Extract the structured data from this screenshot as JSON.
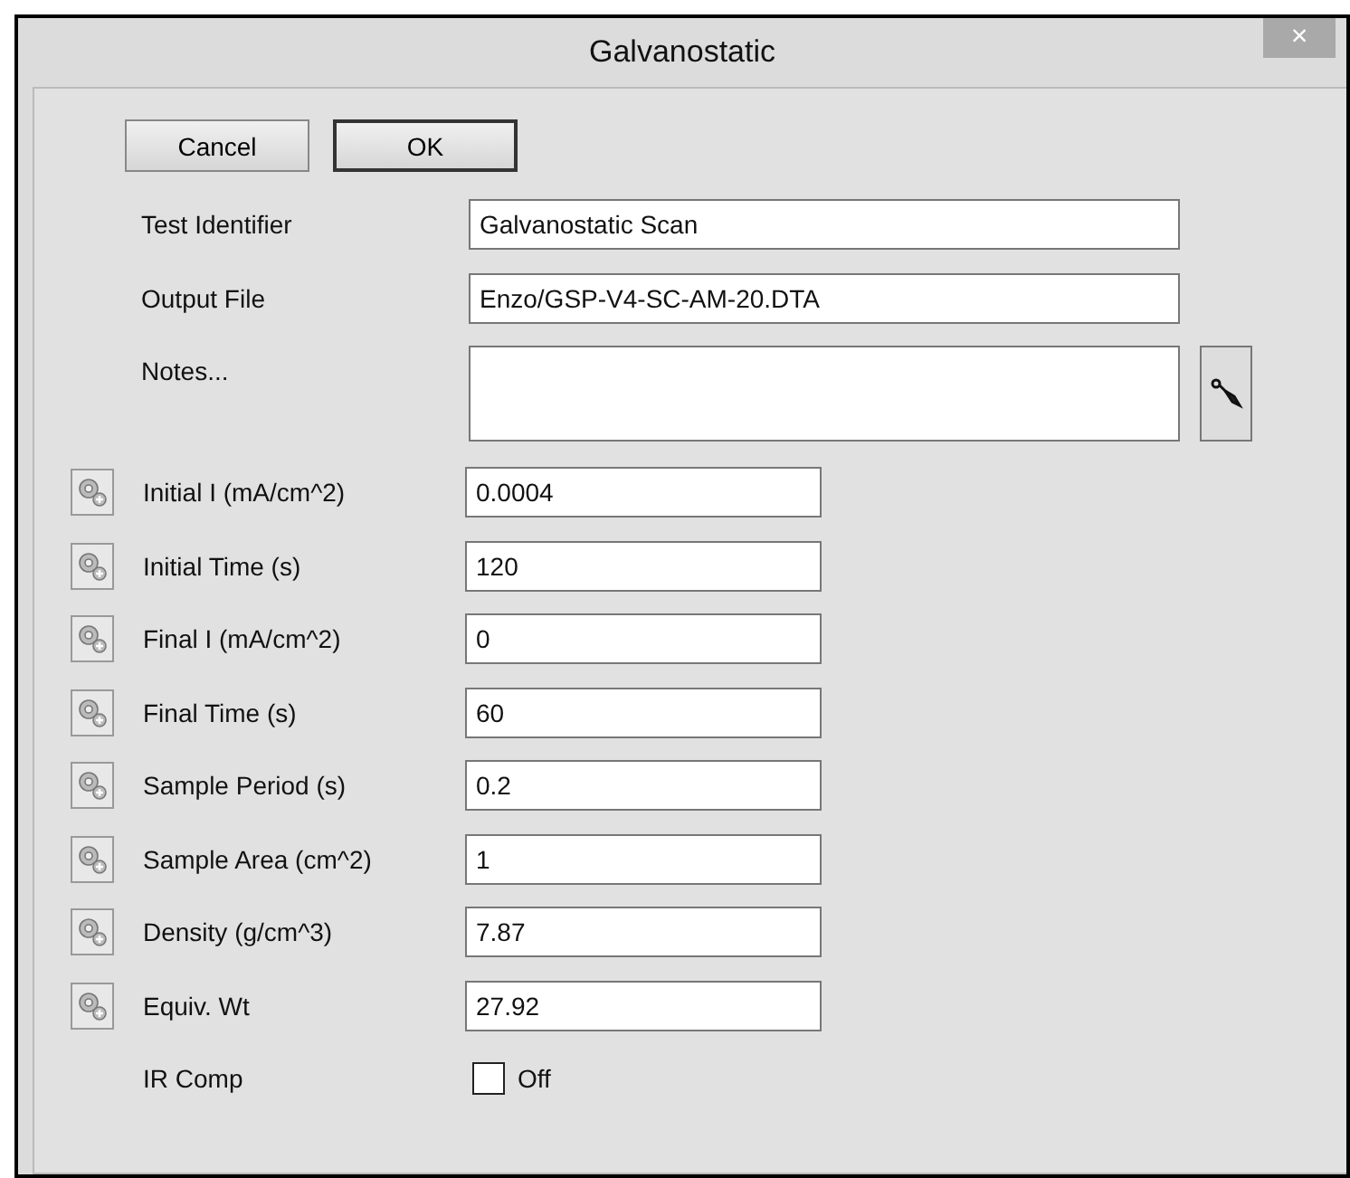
{
  "window": {
    "title": "Galvanostatic",
    "close": "×"
  },
  "buttons": [
    "Cancel",
    "OK"
  ],
  "fields": [
    {
      "label": "Test Identifier",
      "value": "Galvanostatic Scan"
    },
    {
      "label": "Output File",
      "value": "Enzo/GSP-V4-SC-AM-20.DTA"
    }
  ],
  "notes": {
    "label": "Notes..."
  },
  "parameters": [
    {
      "label": "Initial I (mA/cm^2)",
      "value": "0.0004"
    },
    {
      "label": "Initial Time (s)",
      "value": "120"
    },
    {
      "label": "Final I (mA/cm^2)",
      "value": "0"
    },
    {
      "label": "Final Time (s)",
      "value": "60"
    },
    {
      "label": "Sample Period (s)",
      "value": "0.2"
    },
    {
      "label": "Sample Area (cm^2)",
      "value": "1"
    },
    {
      "label": "Density (g/cm^3)",
      "value": "7.87"
    },
    {
      "label": "Equiv. Wt",
      "value": "27.92"
    }
  ],
  "ir_comp": {
    "label": "IR Comp",
    "checked": false,
    "state_text": "Off"
  }
}
